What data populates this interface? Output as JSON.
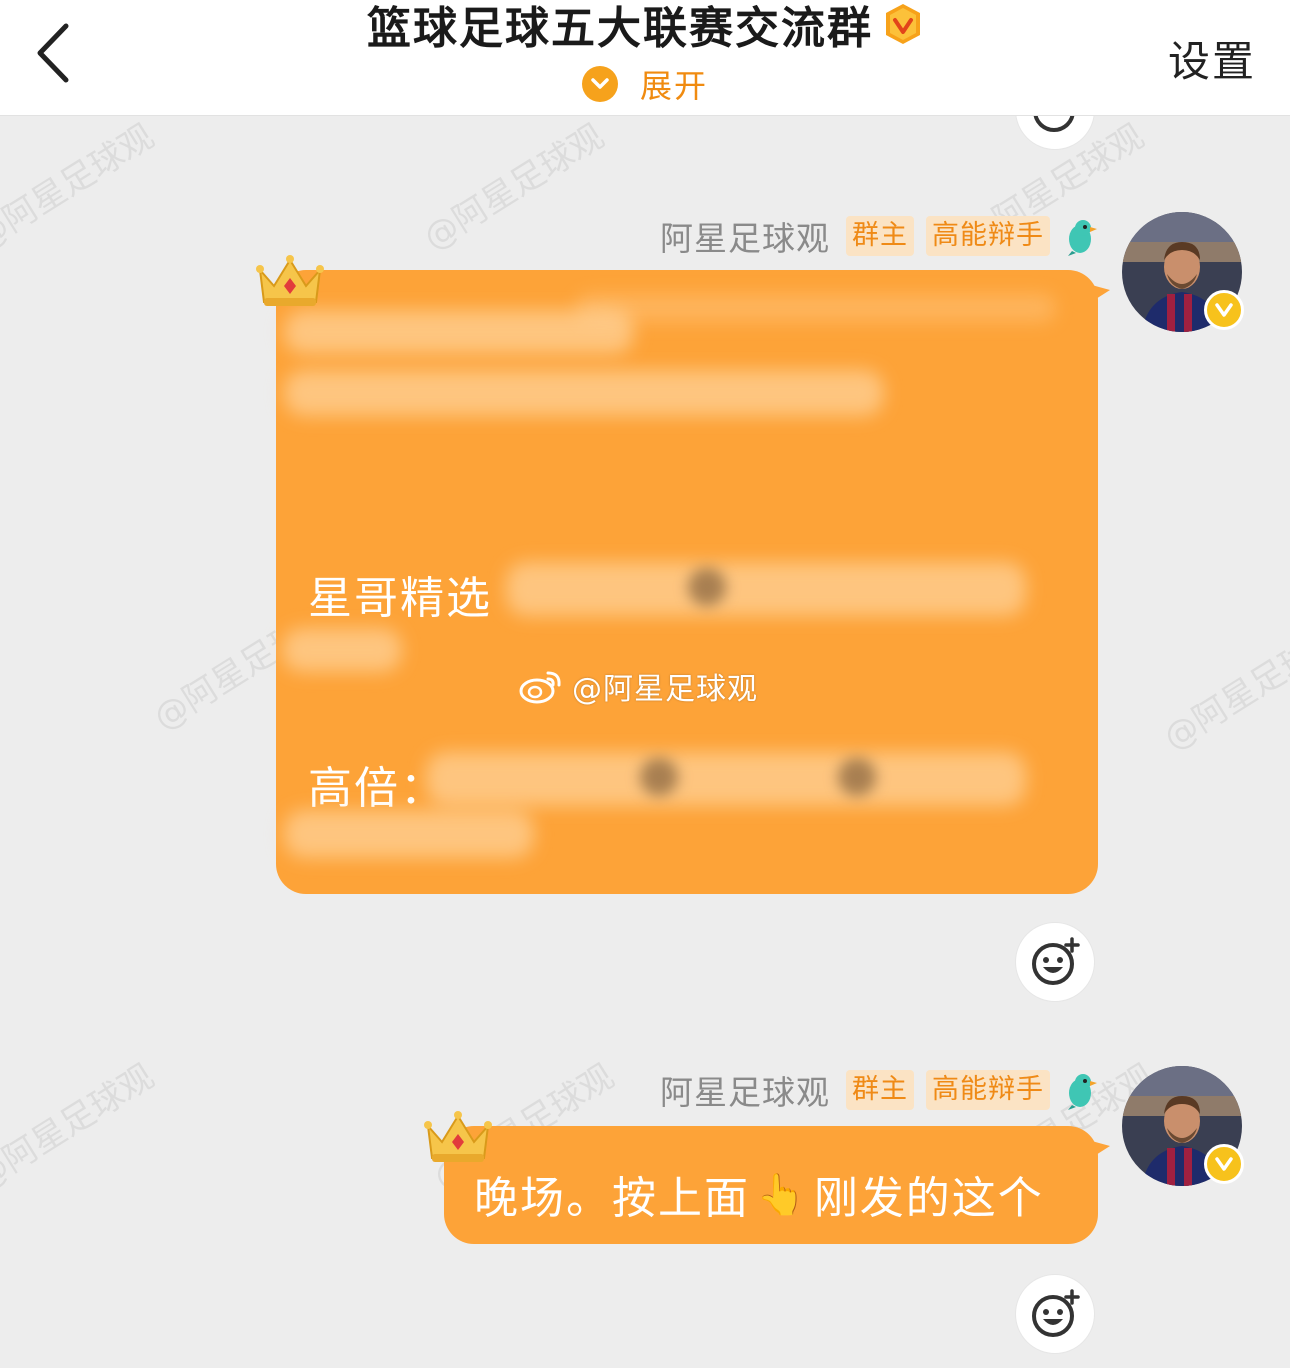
{
  "header": {
    "title": "篮球足球五大联赛交流群",
    "expand_label": "展开",
    "settings_label": "设置"
  },
  "watermark_text": "@阿星足球观",
  "messages": [
    {
      "sender": "阿星足球观",
      "role_tag": "群主",
      "title_tag": "高能辩手",
      "lines": [
        "星哥精选",
        "高倍："
      ],
      "weibo_watermark": "@阿星足球观"
    },
    {
      "sender": "阿星足球观",
      "role_tag": "群主",
      "title_tag": "高能辩手",
      "text_before": "晚场。按上面",
      "emoji": "👆",
      "text_after": "刚发的这个"
    }
  ],
  "colors": {
    "bubble": "#fda338",
    "accent": "#f6a21c",
    "tag_text": "#ef8a16",
    "tag_bg": "#fbe3c4"
  },
  "icons": [
    "back-chevron-icon",
    "verified-v-icon",
    "expand-chevron-icon",
    "bird-icon",
    "crown-icon",
    "emoji-react-icon",
    "weibo-icon"
  ]
}
